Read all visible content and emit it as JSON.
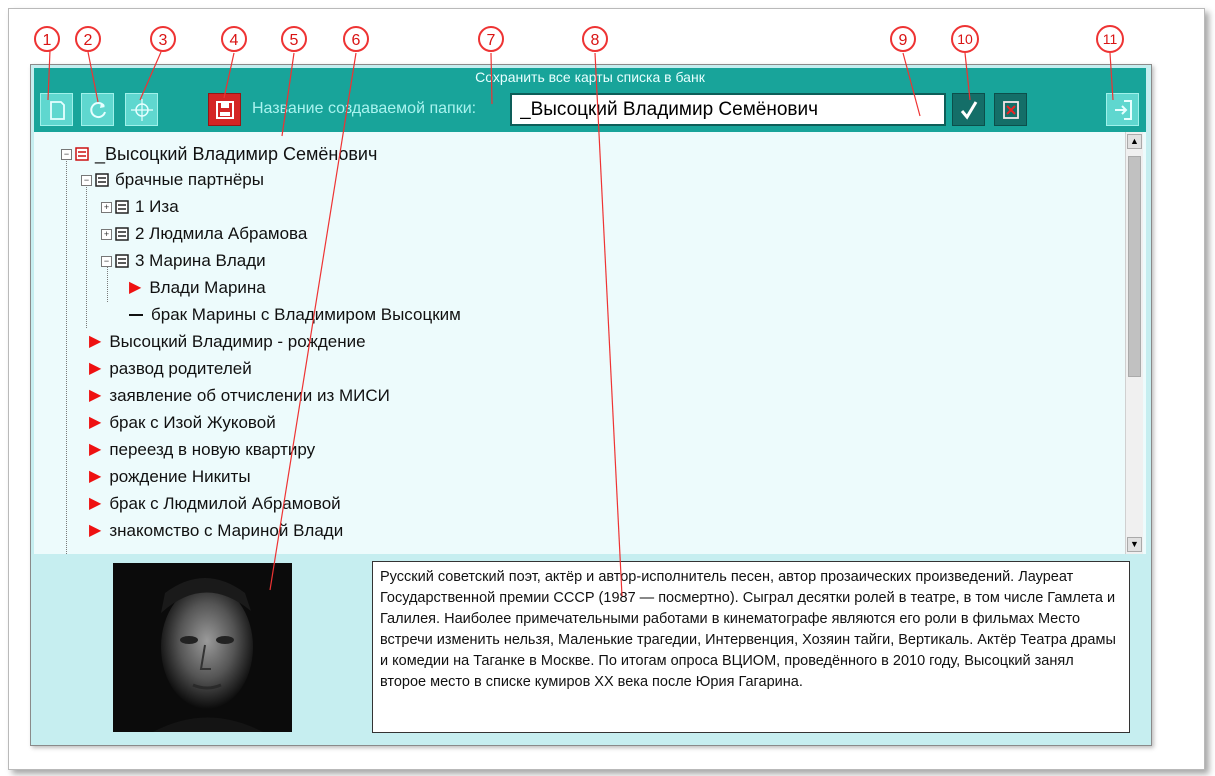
{
  "window": {
    "title": "Сохранить все карты списка в банк",
    "folder_label": "Название создаваемой папки:",
    "folder_value": "_Высоцкий Владимир Семёнович"
  },
  "callouts": [
    "1",
    "2",
    "3",
    "4",
    "5",
    "6",
    "7",
    "8",
    "9",
    "10",
    "11"
  ],
  "toolbar": {
    "icons": [
      "document-icon",
      "refresh-icon",
      "target-icon",
      "save-icon",
      "confirm-checkmark-icon",
      "cancel-icon",
      "exit-icon"
    ]
  },
  "tree": {
    "root": "_Высоцкий Владимир Семёнович",
    "partners": "брачные партнёры",
    "partner_1": "1 Иза",
    "partner_2": "2 Людмила Абрамова",
    "partner_3": "3 Марина Влади",
    "marina_card": "Влади Марина",
    "marriage_card": "брак Марины с Владимиром Высоцким",
    "events": [
      "Высоцкий Владимир - рождение",
      "развод родителей",
      "заявление об отчислении из МИСИ",
      "брак с Изой Жуковой",
      "переезд в новую квартиру",
      "рождение Никиты",
      "брак с Людмилой Абрамовой",
      "знакомство с Мариной Влади"
    ]
  },
  "description": "Русский советский поэт, актёр и автор-исполнитель песен, автор прозаических произведений. Лауреат Государственной премии СССР (1987 — посмертно). Сыграл десятки ролей в театре, в том числе Гамлета и Галилея. Наиболее примечательными работами в кинематографе являются его роли в фильмах Место встречи изменить нельзя, Маленькие трагедии, Интервенция, Хозяин тайги, Вертикаль. Актёр Театра драмы и комедии на Таганке в Москве.  По итогам опроса ВЦИОМ, проведённого в 2010 году, Высоцкий занял второе место в списке кумиров XX века после Юрия Гагарина.",
  "colors": {
    "toolbar": "#18a49a",
    "window_bg": "#c6eef0",
    "tree_bg": "#edfbfc",
    "marker_red": "#ee1111",
    "callout_red": "#e33333"
  }
}
